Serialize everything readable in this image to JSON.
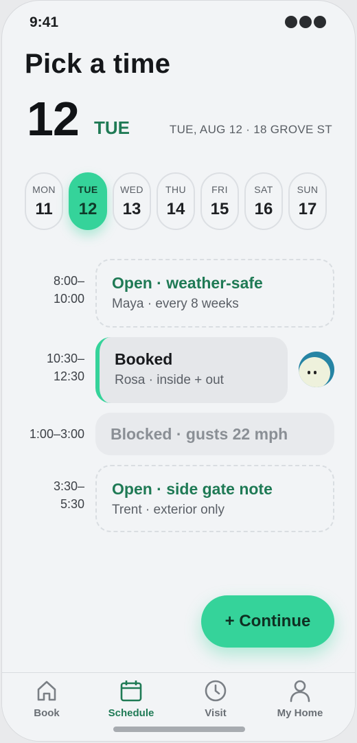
{
  "status": {
    "time": "9:41"
  },
  "header": {
    "title": "Pick a time",
    "date_number": "12",
    "day_label": "TUE",
    "subtitle": "TUE, AUG 12 · 18 GROVE ST"
  },
  "days": [
    {
      "name": "MON",
      "num": "11",
      "selected": false
    },
    {
      "name": "TUE",
      "num": "12",
      "selected": true
    },
    {
      "name": "WED",
      "num": "13",
      "selected": false
    },
    {
      "name": "THU",
      "num": "14",
      "selected": false
    },
    {
      "name": "FRI",
      "num": "15",
      "selected": false
    },
    {
      "name": "SAT",
      "num": "16",
      "selected": false
    },
    {
      "name": "SUN",
      "num": "17",
      "selected": false
    }
  ],
  "slots": [
    {
      "time_start": "8:00–",
      "time_end": "10:00",
      "status": "Open · weather-safe",
      "detail": "Maya · every 8 weeks"
    },
    {
      "time_start": "10:30–",
      "time_end": "12:30",
      "status": "Booked",
      "detail": "Rosa · inside + out"
    },
    {
      "time": "1:00–3:00",
      "status": "Blocked · gusts 22 mph"
    },
    {
      "time_start": "3:30–",
      "time_end": "5:30",
      "status": "Open · side gate note",
      "detail": "Trent · exterior only"
    }
  ],
  "fab": {
    "label": "+ Continue"
  },
  "tabs": [
    {
      "label": "Book",
      "icon": "home-icon",
      "active": false
    },
    {
      "label": "Schedule",
      "icon": "calendar-icon",
      "active": true
    },
    {
      "label": "Visit",
      "icon": "clock-icon",
      "active": false
    },
    {
      "label": "My Home",
      "icon": "person-icon",
      "active": false
    }
  ],
  "colors": {
    "accent": "#35d39a",
    "accent_text": "#1f7a55",
    "background": "#f2f4f6"
  }
}
